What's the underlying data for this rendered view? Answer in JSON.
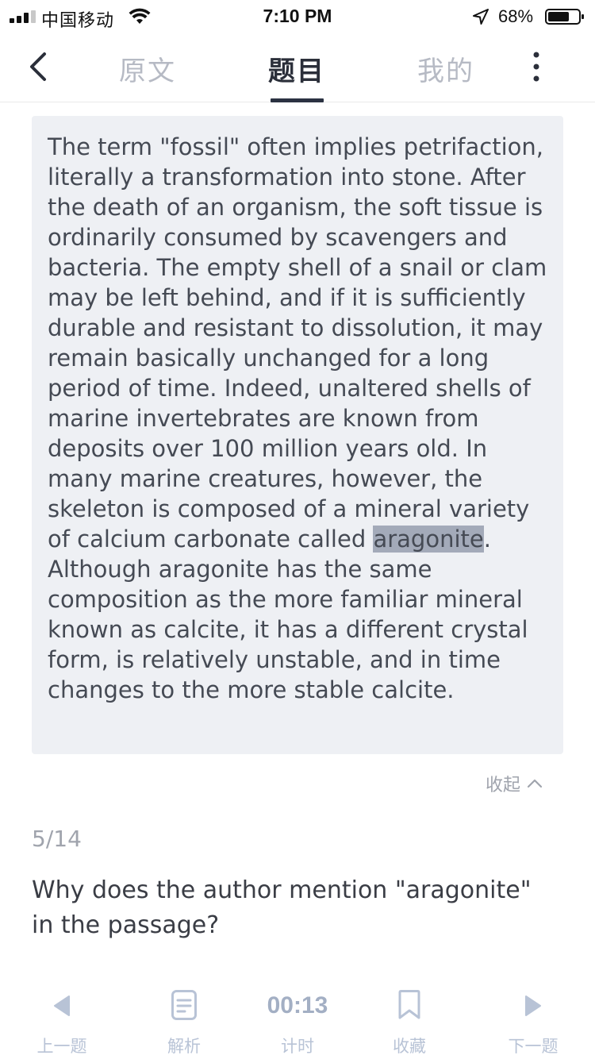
{
  "status_bar": {
    "carrier": "中国移动",
    "time": "7:10 PM",
    "battery_percent": "68%",
    "battery_level": 0.68,
    "icons": [
      "signal-icon",
      "wifi-icon",
      "location-icon",
      "battery-icon"
    ]
  },
  "nav": {
    "tabs": [
      {
        "label": "原文",
        "active": false
      },
      {
        "label": "题目",
        "active": true
      },
      {
        "label": "我的",
        "active": false
      }
    ],
    "icons": [
      "back-chevron-icon",
      "more-vertical-icon"
    ]
  },
  "passage": {
    "before": "The term \"fossil\" often implies petrifaction, literally a transformation into stone. After the death of an organism, the soft tissue is ordinarily consumed by scavengers and bacteria. The empty shell of a snail or clam may be left behind, and if it is sufficiently durable and resistant to dissolution, it may remain basically unchanged for a long period of time. Indeed, unaltered shells of marine invertebrates are known from deposits over 100 million years old. In many marine creatures, however, the skeleton is composed of a mineral variety of calcium carbonate called ",
    "highlight": "aragonite",
    "after": ". Although aragonite has the same composition as the more familiar mineral known as calcite, it has a different crystal form, is relatively unstable, and in time changes to the more stable calcite.",
    "collapse_label": "收起"
  },
  "question": {
    "counter": "5/14",
    "text": "Why does the author mention \"aragonite\" in the passage?"
  },
  "toolbar": {
    "prev_label": "上一题",
    "analysis_label": "解析",
    "timer_value": "00:13",
    "timer_label": "计时",
    "favorite_label": "收藏",
    "next_label": "下一题"
  },
  "colors": {
    "accent_dark": "#2b3242",
    "inactive_tab": "#b6bac4",
    "passage_bg": "#eef0f4",
    "highlight_bg": "#a3aab9",
    "toolbar_icon": "#b8c3d6"
  }
}
